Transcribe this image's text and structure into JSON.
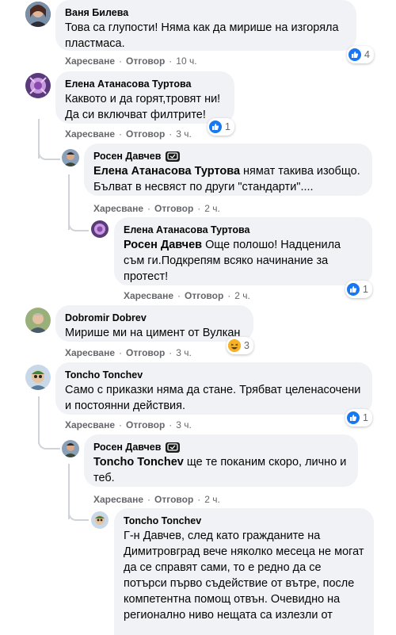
{
  "labels": {
    "like": "Харесване",
    "reply": "Отговор",
    "dot": "·"
  },
  "colors": {
    "like": "#1877f2",
    "bubble": "#f0f2f5",
    "meta": "#65676b"
  },
  "comments": [
    {
      "author": "Ваня Билева",
      "text": "Това са глупости! Няма как да мирише на изгоряла пластмаса.",
      "time": "10 ч.",
      "reactions": "4",
      "reaction_type": "like"
    },
    {
      "author": "Елена Атанасова Туртова",
      "text": "Каквото и да горят,тровят ни!\nДа си включват филтрите!",
      "time": "3 ч.",
      "reactions": "1",
      "reaction_type": "like"
    },
    {
      "author": "Росен Давчев",
      "mention": "Елена Атанасова Туртова",
      "text": " нямат такива изобщо. Бълват в несвяст по други \"стандарти\"....",
      "time": "2 ч.",
      "badge": "author-badge-icon"
    },
    {
      "author": "Елена Атанасова Туртова",
      "mention": "Росен Давчев",
      "text": " Още полошо! Надценила съм ги.Подкрепям всяко начинание за протест!",
      "time": "2 ч.",
      "reactions": "1",
      "reaction_type": "like"
    },
    {
      "author": "Dobromir Dobrev",
      "text": "Мирише ми на цимент от Вулкан",
      "time": "3 ч.",
      "reactions": "3",
      "reaction_type": "haha"
    },
    {
      "author": "Toncho Tonchev",
      "text": "Само с приказки няма да стане. Трябват целенасочени и постоянни действия.",
      "time": "3 ч.",
      "reactions": "1",
      "reaction_type": "like"
    },
    {
      "author": "Росен Давчев",
      "mention": "Toncho Tonchev",
      "text": " ще те поканим скоро, лично и теб.",
      "time": "2 ч.",
      "badge": "author-badge-icon"
    },
    {
      "author": "Toncho Tonchev",
      "text": "Г-н Давчев, след като гражданите на Димитровград вече няколко месеца не могат да се справят сами, то е редно да се потърси първо съдействие от вътре, после компетентна помощ отвън. Очевидно на регионално ниво нещата са излезли от"
    }
  ]
}
